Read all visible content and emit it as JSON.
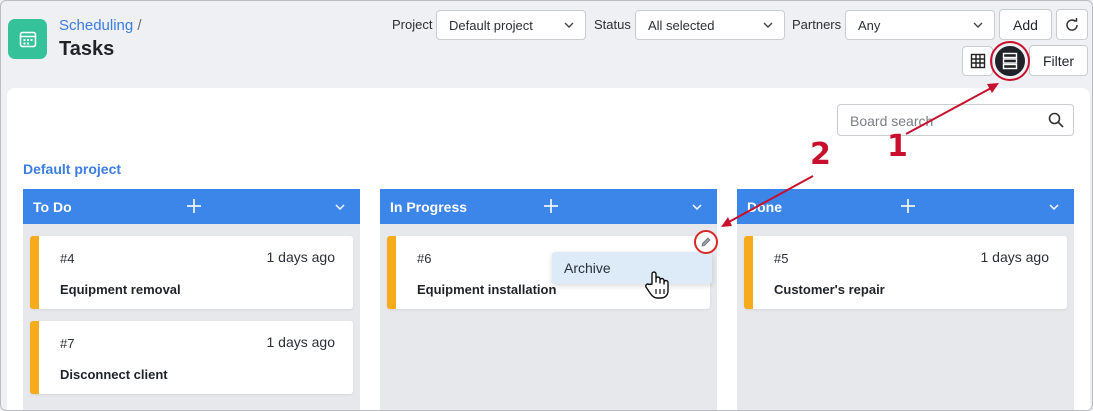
{
  "header": {
    "breadcrumb": "Scheduling",
    "breadcrumb_sep": "/",
    "title": "Tasks"
  },
  "filters": {
    "project_label": "Project",
    "project_value": "Default project",
    "status_label": "Status",
    "status_value": "All selected",
    "partners_label": "Partners",
    "partners_value": "Any"
  },
  "toolbar": {
    "add_label": "Add",
    "filter_label": "Filter",
    "active_view": "list-view"
  },
  "board": {
    "search_placeholder": "Board search",
    "project_name": "Default project",
    "columns": [
      {
        "title": "To Do",
        "cards": [
          {
            "id": "#4",
            "age": "1 days ago",
            "title": "Equipment removal"
          },
          {
            "id": "#7",
            "age": "1 days ago",
            "title": "Disconnect client"
          }
        ]
      },
      {
        "title": "In Progress",
        "cards": [
          {
            "id": "#6",
            "age": "",
            "title": "Equipment installation"
          }
        ]
      },
      {
        "title": "Done",
        "cards": [
          {
            "id": "#5",
            "age": "1 days ago",
            "title": "Customer's repair"
          }
        ]
      }
    ]
  },
  "context_menu": {
    "item": "Archive"
  },
  "annotations": {
    "step1": "1",
    "step2": "2",
    "color": "#c8102e"
  },
  "colors": {
    "accent": "#3c86ea",
    "card_stripe": "#f5ab1c",
    "app_icon": "#35c29a"
  }
}
